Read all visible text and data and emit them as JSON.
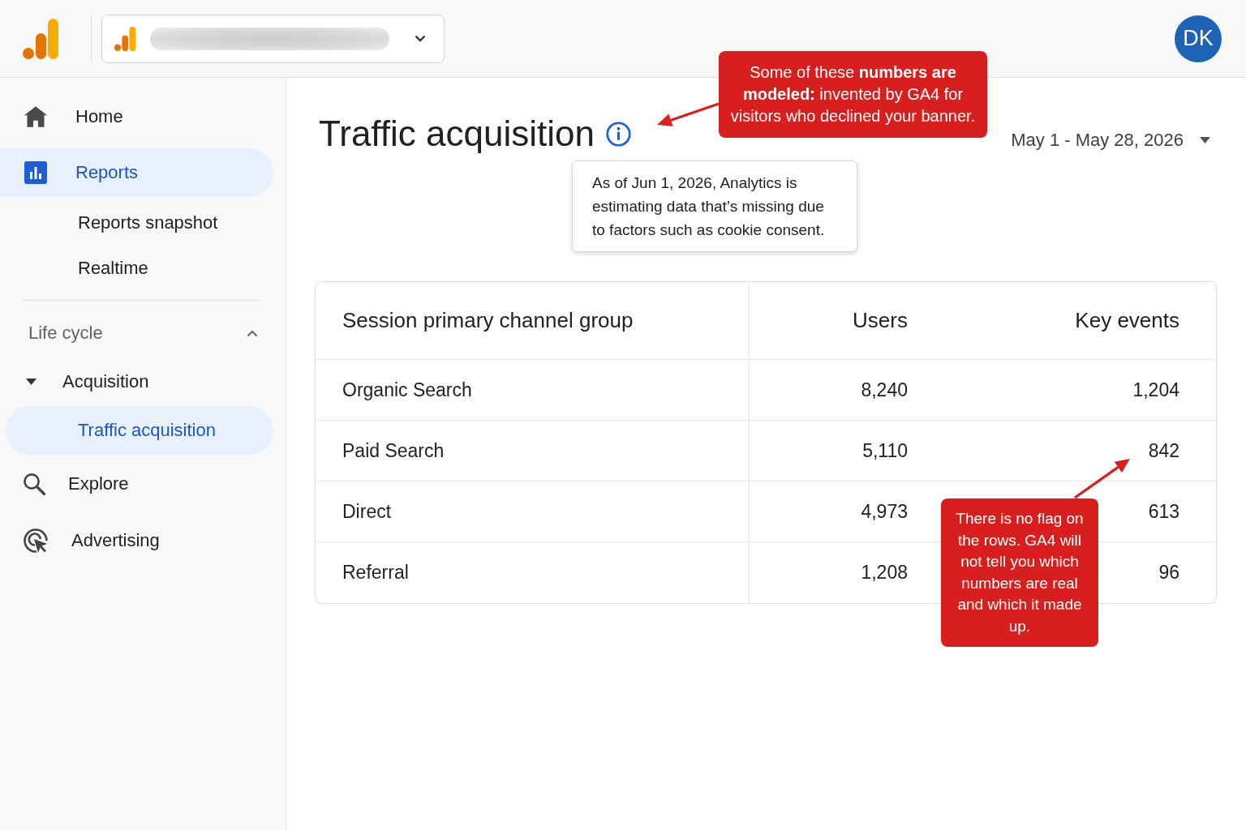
{
  "top_bar": {
    "avatar": {
      "initials": "DK"
    }
  },
  "sidebar": {
    "items": [
      {
        "label": "Home",
        "selected": false
      },
      {
        "label": "Reports",
        "selected": true,
        "children": [
          {
            "label": "Reports snapshot",
            "selected": false
          },
          {
            "label": "Realtime",
            "selected": false
          }
        ]
      }
    ],
    "sections": [
      {
        "label": "Life cycle",
        "expanded": true,
        "children": [
          {
            "label": "Acquisition",
            "expanded": true,
            "children": [
              {
                "label": "Traffic acquisition",
                "selected": true
              }
            ]
          }
        ]
      }
    ],
    "bottom_items": [
      {
        "label": "Explore",
        "selected": false
      },
      {
        "label": "Advertising",
        "selected": false
      }
    ]
  },
  "page": {
    "title": "Traffic acquisition",
    "date_range": "May 1 - May 28, 2026",
    "info_tooltip": "As of Jun 1, 2026, Analytics is estimating data that’s missing due to factors such as cookie consent."
  },
  "table": {
    "columns": [
      "Session primary channel group",
      "Users",
      "Key events"
    ],
    "rows": [
      [
        "Organic Search",
        "8,240",
        "1,204"
      ],
      [
        "Paid Search",
        "5,110",
        "842"
      ],
      [
        "Direct",
        "4,973",
        "613"
      ],
      [
        "Referral",
        "1,208",
        "96"
      ]
    ]
  },
  "annotations": [
    {
      "text": "Some of these **numbers are modeled:** invented by GA4 for visitors who declined your banner."
    },
    {
      "text": "There is no flag on the rows. GA4 will not tell you which numbers are real and which it made up."
    }
  ]
}
